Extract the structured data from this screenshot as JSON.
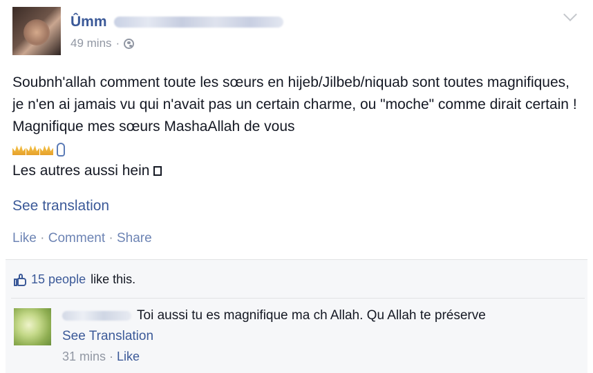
{
  "post": {
    "author_visible": "Ûmm",
    "timestamp": "49 mins",
    "timestamp_sep": "·",
    "body_line1": "Soubnh'allah comment toute les sœurs en hijeb/Jilbeb/niquab sont toutes magnifiques, je n'en ai jamais vu qui n'avait pas un certain charme, ou \"moche\" comme dirait certain ! Magnifique mes sœurs MashaAllah de vous",
    "body_line2": "Les autres aussi hein",
    "see_translation": "See translation",
    "actions": {
      "like": "Like",
      "comment": "Comment",
      "share": "Share",
      "sep": " · "
    }
  },
  "feedback": {
    "likes_count_link": "15 people",
    "likes_suffix": "like this."
  },
  "comment": {
    "text": "Toi aussi tu es magnifique ma ch Allah. Qu Allah te préserve",
    "see_translation": "See Translation",
    "timestamp": "31 mins",
    "sep": " · ",
    "like": "Like"
  },
  "colors": {
    "link": "#3b5998",
    "meta": "#9197a3",
    "text": "#141823",
    "feedback_bg": "#f6f7f9"
  },
  "icons": [
    "globe-icon",
    "chevron-down-icon",
    "crown-icon",
    "pointing-hand-icon",
    "thumbs-up-icon"
  ]
}
